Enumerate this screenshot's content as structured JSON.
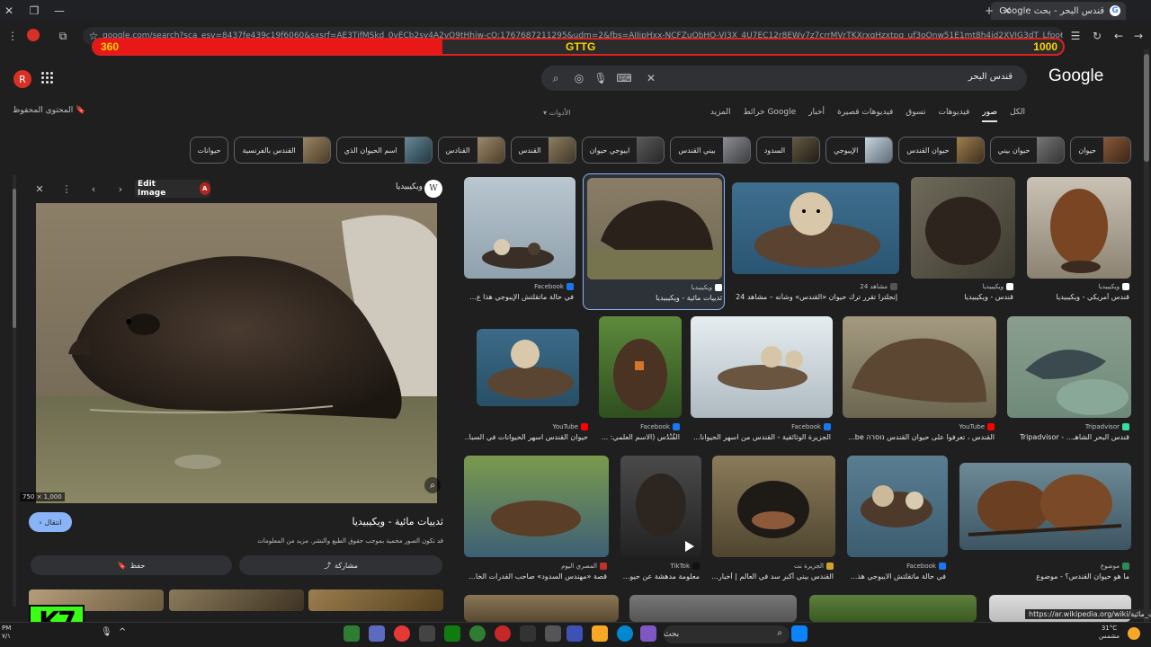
{
  "browser": {
    "tab_title": "قندس البحر - بحث Google",
    "address_url": "google.com/search?sca_esv=8437fe439c19f6060&sxsrf=AE3TifMSkd_0vECb2sv4A2vO9tHhjw-cQ:1767687211295&udm=2&fbs=AIIjpHxx-NCFZuObHQ-VI3X_4U7EC12r8EWv7z7crrMVrTKXrxqHzxtpq_uf3oOnw51E1mt8h4jd2XVJG3dT_Lfpo6m6P_NmGdA_rQ_KIuSqYBiIIY4d0Fn0zs&q=bs&ved=1t:1"
  },
  "game_overlay": {
    "left_score": "360",
    "center_label": "GTTG",
    "right_score": "1000",
    "fill_fraction": 0.36
  },
  "header": {
    "avatar_letter": "R",
    "logo": "Google",
    "search_query": "قندس البحر",
    "saved_label": "المحتوى المحفوظ"
  },
  "nav_tabs": [
    "الكل",
    "صور",
    "فيديوهات",
    "تسوق",
    "فيديوهات قصيرة",
    "أخبار",
    "خرائط Google",
    "المزيد"
  ],
  "tools_label": "الأدوات",
  "chips": [
    "حيوان",
    "حيوان بيني",
    "حيوان القندس",
    "الإيبوجي",
    "السدود",
    "بيني القندس",
    "ايبوجي حيوان",
    "القندس",
    "القنادس",
    "اسم الحيوان الذي",
    "القندس بالفرنسية",
    "حيوانات"
  ],
  "panel": {
    "edit_label": "Edit Image",
    "pdf_badge": "A",
    "source_name": "ويكيبيديا",
    "source_letter": "W",
    "image_size": "750 × 1,000",
    "visit_label": "انتقال",
    "title": "ثدييات مائية - ويكيبيديا",
    "copyright": "قد تكون الصور محمية بموجب حقوق الطبع والنشر. مزيد من المعلومات",
    "save_label": "حفظ",
    "share_label": "مشاركة"
  },
  "results": [
    {
      "source": "Facebook",
      "caption": "في حالة ماتقلتش الإيبوجي هذا ع..."
    },
    {
      "source": "ويكيبيديا",
      "caption": "ثدييات مائية - ويكيبيديا"
    },
    {
      "source": "مشاهد 24",
      "caption": "إنجلترا تقرر ترك حيوان «القندس» وشأنه – مشاهد 24"
    },
    {
      "source": "ويكيبيديا",
      "caption": "قندس - ويكيبيديا"
    },
    {
      "source": "ويكيبيديا",
      "caption": "قندس أمريكي - ويكيبيديا"
    },
    {
      "source": "YouTube",
      "caption": "حيوان القندس اسهر الحيوانات في السبا..."
    },
    {
      "source": "Facebook",
      "caption": "القُنْدُس (الاسم العلمي: ..."
    },
    {
      "source": "Facebook",
      "caption": "الجزيرة الوثائقية - القندس من اسهر الحيوانا..."
    },
    {
      "source": "YouTube",
      "caption": "القندس ، تعرفوا على حيوان القندس נוסרה be..."
    },
    {
      "source": "Tripadvisor",
      "caption": "قندس البحر الشاهـ... - Tripadvisor"
    },
    {
      "source": "المصري اليوم",
      "caption": "قصة «مهندس السدود» صاحب القدرات الخا..."
    },
    {
      "source": "TikTok",
      "caption": "معلومة مدهشة عن حيو..."
    },
    {
      "source": "الجزيرة نت",
      "caption": "القندس بيني أكبر سد في العالم | أخبار..."
    },
    {
      "source": "Facebook",
      "caption": "في حالة ماتقلتش الايبوجي هذ..."
    },
    {
      "source": "موضوع",
      "caption": "ما هو حيوان القندس؟ - موضوع"
    }
  ],
  "status_url": "https://ar.wikipedia.org/wiki/ثدييات_مائية",
  "watermark": "K7",
  "taskbar": {
    "search_placeholder": "بحث",
    "temperature": "31°C",
    "weather": "مشمس",
    "time": "٧/١",
    "date": "PM"
  },
  "colors": {
    "accent": "#8ab4f8",
    "overlay_red": "#e81818",
    "overlay_text": "#ffd400",
    "watermark_green": "#39ff14"
  }
}
